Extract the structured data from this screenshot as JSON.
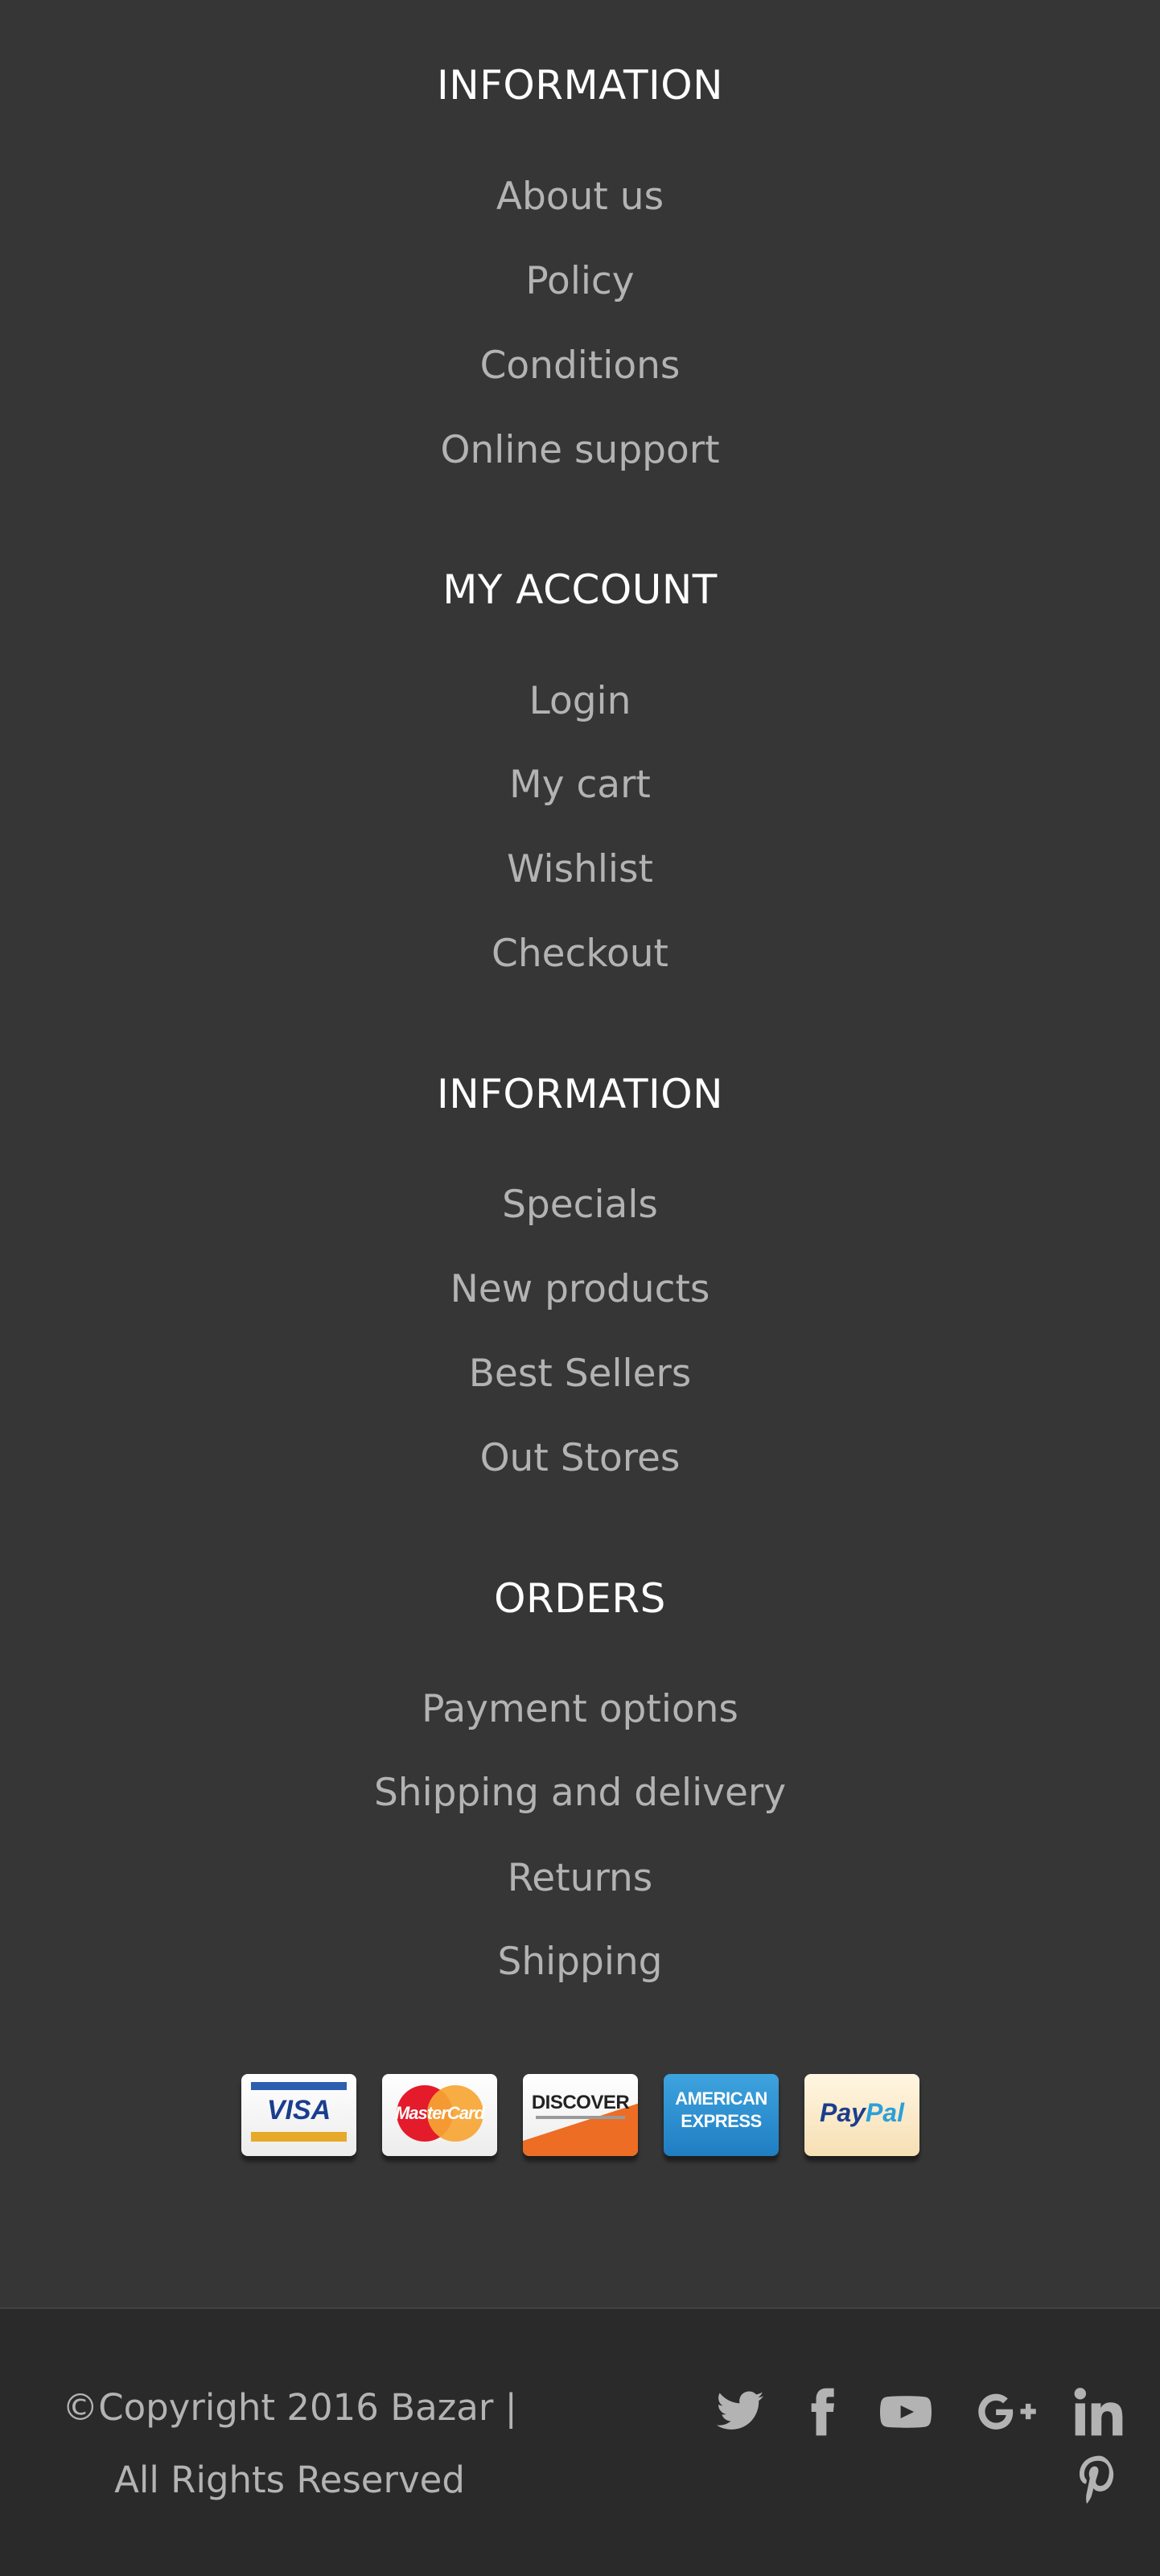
{
  "sections": [
    {
      "title": "INFORMATION",
      "links": [
        "About us",
        "Policy",
        "Conditions",
        "Online support"
      ]
    },
    {
      "title": "MY ACCOUNT",
      "links": [
        "Login",
        "My cart",
        "Wishlist",
        "Checkout"
      ]
    },
    {
      "title": "INFORMATION",
      "links": [
        "Specials",
        "New products",
        "Best Sellers",
        "Out Stores"
      ]
    },
    {
      "title": "ORDERS",
      "links": [
        "Payment options",
        "Shipping and delivery",
        "Returns",
        "Shipping"
      ]
    }
  ],
  "payments": {
    "visa": "VISA",
    "mastercard": "MasterCard",
    "discover": "DISCOVER",
    "amex_line1": "AMERICAN",
    "amex_line2": "EXPRESS",
    "paypal_a": "Pay",
    "paypal_b": "Pal"
  },
  "bottom": {
    "copyright_line1": "©Copyright 2016 Bazar |",
    "copyright_line2": "All Rights Reserved"
  },
  "social_icons": [
    "twitter-icon",
    "facebook-icon",
    "youtube-icon",
    "google-plus-icon",
    "linkedin-icon",
    "pinterest-icon"
  ],
  "colors": {
    "background": "#363636",
    "bottom_bar": "#2a2a2a",
    "heading": "#ffffff",
    "link": "#b3b3b3"
  }
}
